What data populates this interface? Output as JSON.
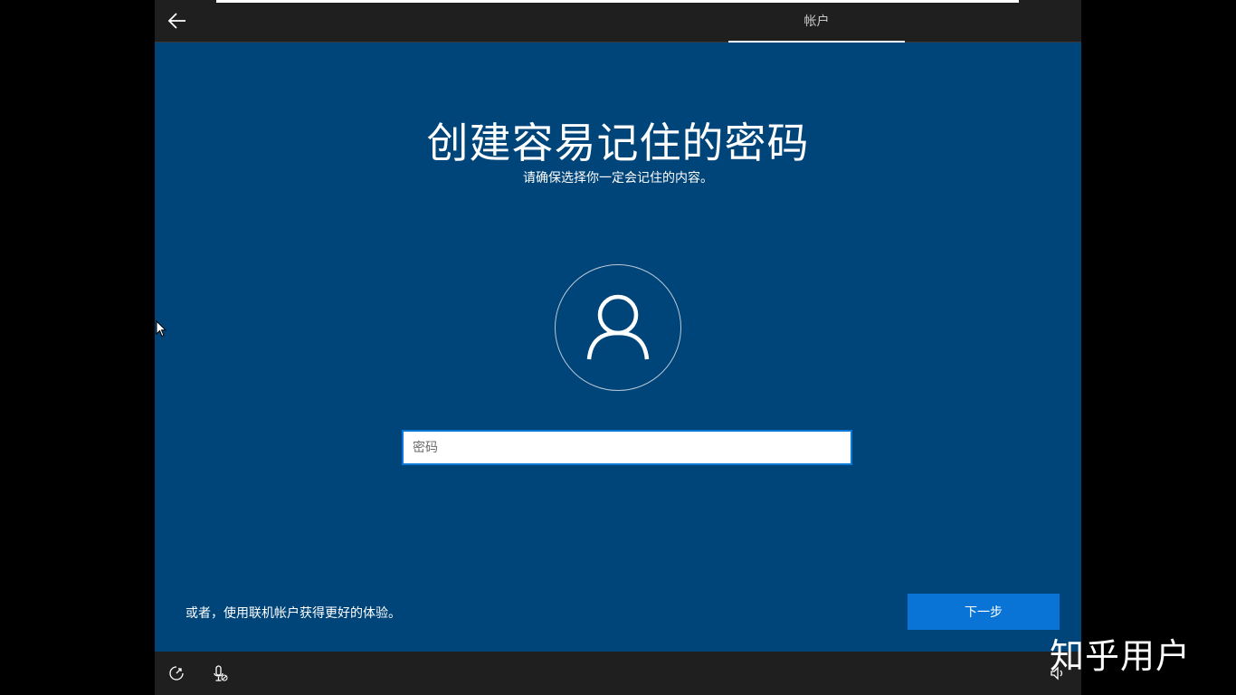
{
  "header": {
    "back_icon": "back-arrow-icon",
    "tab_label": "帐户"
  },
  "main": {
    "title": "创建容易记住的密码",
    "subtitle": "请确保选择你一定会记住的内容。",
    "avatar_icon": "user-icon",
    "password": {
      "value": "",
      "placeholder": "密码"
    },
    "online_account_link": "或者，使用联机帐户获得更好的体验。",
    "next_label": "下一步"
  },
  "footer": {
    "icons": [
      "ease-of-access-icon",
      "microphone-icon",
      "volume-icon"
    ]
  },
  "watermark": "知乎用户",
  "colors": {
    "background": "#00457a",
    "bars": "#1f1f1f",
    "accent": "#0a74d6"
  }
}
